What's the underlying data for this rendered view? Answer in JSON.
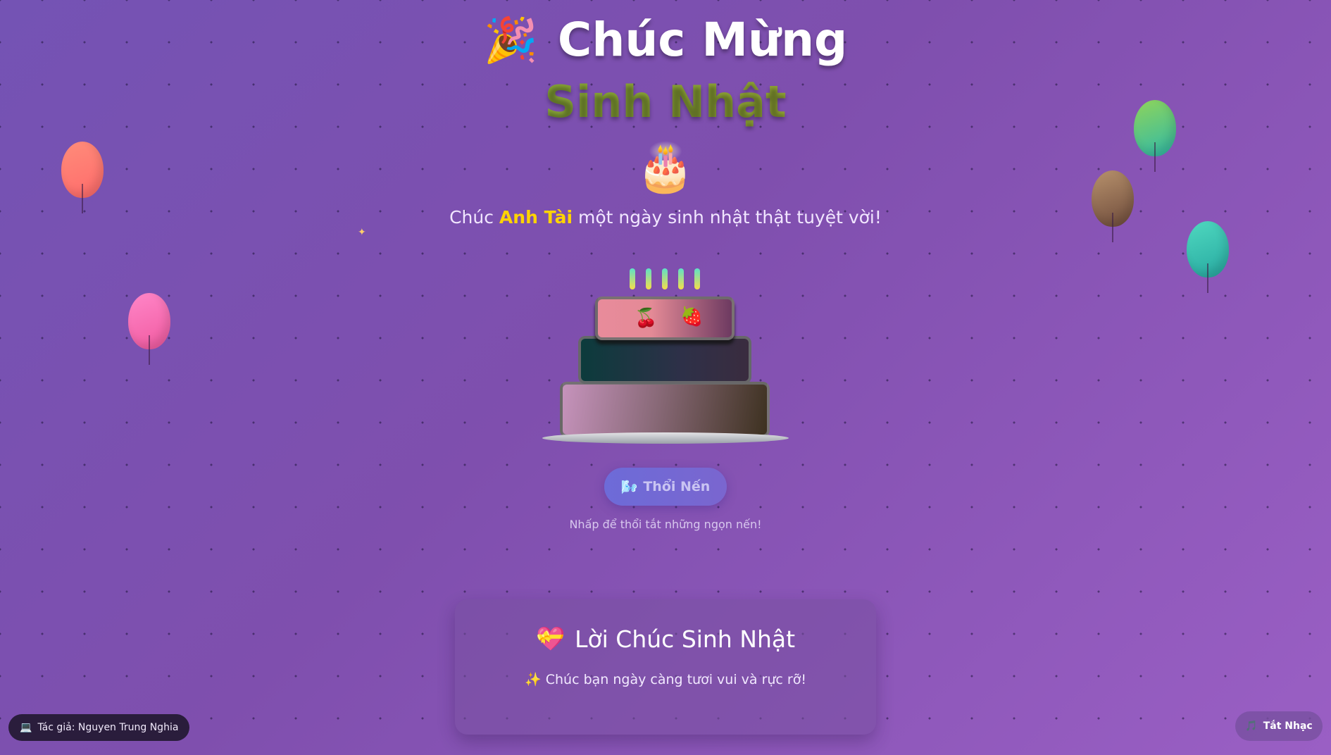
{
  "header": {
    "party_emoji": "🎉",
    "title": "Chúc Mừng",
    "subtitle": "Sinh Nhật",
    "cake_emoji": "🎂"
  },
  "greeting": {
    "prefix": "Chúc ",
    "name": "Anh Tài",
    "suffix": " một ngày sinh nhật thật tuyệt vời!"
  },
  "cake": {
    "candle_count": 5,
    "fruits": [
      "🍒",
      "🍓"
    ]
  },
  "blow_button": {
    "icon": "🌬️",
    "label": "Thổi Nến"
  },
  "hint": "Nhấp để thổi tắt những ngọn nến!",
  "wishes": {
    "icon": "💝",
    "title": "Lời Chúc Sinh Nhật",
    "line": "✨ Chúc bạn ngày càng tươi vui và rực rỡ!"
  },
  "footer": {
    "author_icon": "💻",
    "author": "Tác giả: Nguyen Trung Nghia",
    "music_icon": "🎵",
    "music_label": "Tắt Nhạc"
  },
  "colors": {
    "name_highlight": "#ffd400",
    "button": "#6d6bd8"
  }
}
